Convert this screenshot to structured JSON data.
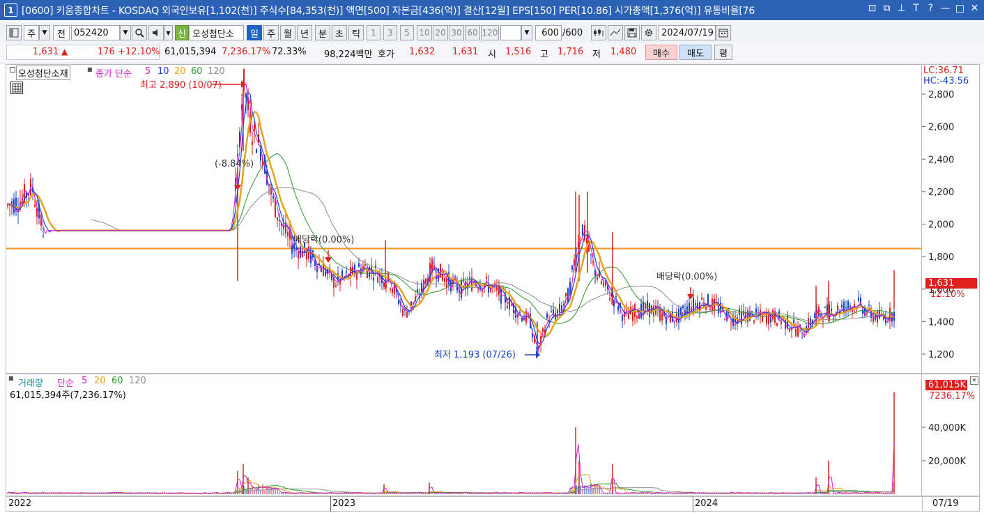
{
  "title_bar": {
    "window_number": "1",
    "title": "[0600] 키움종합차트 - KOSDAQ 외국인보유[1,102(천)] 주식수[84,353(천)] 액면[500] 자본금[436(억)] 결산[12월] EPS[150] PER[10.86] 시가총액[1,376(억)] 유통비율[76",
    "buttons": [
      "⊡",
      "⧉",
      "⊥",
      "T",
      "?",
      "—",
      "□",
      "✕"
    ]
  },
  "toolbar": {
    "jong_label": "주",
    "jeon_label": "전",
    "stock_code": "052420",
    "sin_label": "신",
    "stock_name": "오성첨단소",
    "period_buttons": [
      "일",
      "주",
      "월",
      "년",
      "분",
      "초",
      "틱"
    ],
    "active_period": "일",
    "number_buttons": [
      "1",
      "3",
      "5",
      "10",
      "20",
      "30",
      "60",
      "120"
    ],
    "count_value": "600",
    "count_total": "/600",
    "date_value": "2024/07/19"
  },
  "quote_bar": {
    "price": "1,631",
    "change_arrow": "▲",
    "change": "176",
    "change_pct": "+12.10%",
    "volume": "61,015,394",
    "volume_pct": "7,236.17%",
    "turnover_pct": "72.33%",
    "amount": "98,224백만",
    "hoga_label": "호가",
    "hoga_ask": "1,632",
    "hoga_bid": "1,631",
    "open_label": "시",
    "open": "1,516",
    "high_label": "고",
    "high": "1,716",
    "low_label": "저",
    "low": "1,480",
    "buy_label": "매수",
    "sell_label": "매도",
    "pyeong_label": "평"
  },
  "price_panel": {
    "stock_tag": "오성첨단소재",
    "ma_header": {
      "label": "종가 단순",
      "p5": "5",
      "p10": "10",
      "p20": "20",
      "p60": "60",
      "p120": "120"
    },
    "annotations": {
      "high": "최고 2,890 (10/07)",
      "low": "최저 1,193 (07/26)",
      "pct": "(-8.84%)",
      "div1": "배당락(0.00%)",
      "div2": "배당락(0.00%)"
    },
    "axis_labels": [
      "2,800",
      "2,600",
      "2,400",
      "2,200",
      "2,000",
      "1,800",
      "1,600",
      "1,400",
      "1,200"
    ],
    "lc": "LC:36.71",
    "hc": "HC:-43.56",
    "current_price": "1,631",
    "current_pct": "12.10%"
  },
  "volume_panel": {
    "header": {
      "label": "거래량",
      "ma_label": "단순",
      "p5": "5",
      "p20": "20",
      "p60": "60",
      "p120": "120"
    },
    "volume_text": "61,015,394주(7,236.17%)",
    "axis_labels": [
      "40,000K",
      "20,000K"
    ],
    "current_volume": "61,015K",
    "current_pct": "7236.17%"
  },
  "date_axis": {
    "labels": [
      "2022",
      "2023",
      "2024"
    ],
    "current": "07/19"
  },
  "colors": {
    "up": "#e0201c",
    "down": "#1744c9",
    "ma5": "#d61fd0",
    "ma10": "#1f3fd0",
    "ma20": "#e8a21b",
    "ma60": "#2a9a2a",
    "ma120": "#8c8c8c",
    "title_bar": "#2c62b5",
    "hline": "#f0941f"
  },
  "chart_data": [
    {
      "type": "candlestick",
      "title": "오성첨단소재 종가 단순",
      "y_axis_ticks": [
        1200,
        1400,
        1600,
        1800,
        2000,
        2200,
        2400,
        2600,
        2800
      ],
      "ylim": [
        1140,
        2960
      ],
      "x_axis_labels": [
        "2022",
        "2023",
        "2024",
        "07/19"
      ],
      "points": [
        [
          0,
          2080
        ],
        [
          12,
          2120
        ],
        [
          30,
          2150
        ],
        [
          45,
          2230
        ],
        [
          55,
          2060
        ],
        [
          60,
          1960
        ],
        [
          90,
          1960
        ],
        [
          150,
          1960
        ],
        [
          250,
          1960
        ],
        [
          330,
          1960
        ],
        [
          340,
          2360
        ],
        [
          348,
          2890
        ],
        [
          360,
          2580
        ],
        [
          375,
          2450
        ],
        [
          390,
          2150
        ],
        [
          405,
          1980
        ],
        [
          420,
          1860
        ],
        [
          440,
          1820
        ],
        [
          460,
          1740
        ],
        [
          480,
          1640
        ],
        [
          500,
          1680
        ],
        [
          520,
          1740
        ],
        [
          540,
          1700
        ],
        [
          560,
          1640
        ],
        [
          580,
          1450
        ],
        [
          600,
          1560
        ],
        [
          620,
          1740
        ],
        [
          640,
          1660
        ],
        [
          660,
          1600
        ],
        [
          680,
          1650
        ],
        [
          700,
          1620
        ],
        [
          720,
          1560
        ],
        [
          740,
          1470
        ],
        [
          760,
          1400
        ],
        [
          770,
          1193
        ],
        [
          785,
          1430
        ],
        [
          800,
          1450
        ],
        [
          815,
          1560
        ],
        [
          825,
          1820
        ],
        [
          835,
          1980
        ],
        [
          850,
          1740
        ],
        [
          865,
          1620
        ],
        [
          880,
          1540
        ],
        [
          895,
          1430
        ],
        [
          910,
          1460
        ],
        [
          930,
          1480
        ],
        [
          950,
          1440
        ],
        [
          970,
          1420
        ],
        [
          990,
          1500
        ],
        [
          1010,
          1530
        ],
        [
          1030,
          1480
        ],
        [
          1050,
          1420
        ],
        [
          1070,
          1440
        ],
        [
          1090,
          1430
        ],
        [
          1110,
          1430
        ],
        [
          1130,
          1390
        ],
        [
          1150,
          1330
        ],
        [
          1170,
          1440
        ],
        [
          1190,
          1460
        ],
        [
          1210,
          1490
        ],
        [
          1230,
          1510
        ],
        [
          1250,
          1440
        ],
        [
          1265,
          1420
        ],
        [
          1280,
          1450
        ]
      ],
      "annotations": [
        {
          "label": "최고 2,890 (10/07)",
          "value": 2890
        },
        {
          "label": "최저 1,193 (07/26)",
          "value": 1193
        },
        {
          "label": "(-8.84%)"
        },
        {
          "label": "배당락(0.00%)"
        },
        {
          "label": "배당락(0.00%)"
        }
      ],
      "horizontal_line": 1850
    },
    {
      "type": "bar",
      "title": "거래량 단순",
      "y_axis_ticks": [
        20000,
        40000
      ],
      "unit": "K",
      "spikes": [
        [
          340,
          14000
        ],
        [
          348,
          18000
        ],
        [
          355,
          10000
        ],
        [
          550,
          6000
        ],
        [
          615,
          7000
        ],
        [
          825,
          40000
        ],
        [
          830,
          20000
        ],
        [
          878,
          18000
        ],
        [
          1170,
          10000
        ],
        [
          1188,
          20000
        ],
        [
          1282,
          61015
        ]
      ]
    }
  ]
}
